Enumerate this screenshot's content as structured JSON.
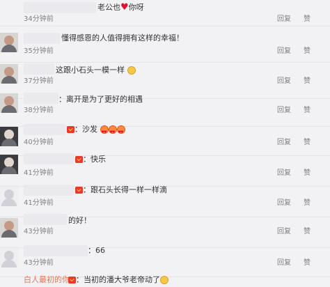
{
  "actions": {
    "reply_label": "回复",
    "like_label": "赞"
  },
  "comments": [
    {
      "name": "",
      "text": "老公也",
      "text2": "你呀",
      "time": "34分钟前"
    },
    {
      "name": "",
      "text": "懂得感恩的人值得拥有这样的幸福！",
      "time": "35分钟前"
    },
    {
      "name": "",
      "text": "这跟小石头一模一样",
      "time": "37分钟前"
    },
    {
      "name": "",
      "text": "：离开是为了更好的相遇",
      "time": "38分钟前"
    },
    {
      "name": "",
      "text": "：沙发",
      "time": "40分钟前"
    },
    {
      "name": "",
      "text": "：快乐",
      "time": "41分钟前"
    },
    {
      "name": "",
      "text": "：跟石头长得一样一样滴",
      "time": "41分钟前"
    },
    {
      "name": "",
      "text": "的好！",
      "time": "43分钟前"
    },
    {
      "name": "",
      "text": "：66",
      "time": "43分钟前"
    },
    {
      "name": "白人最初的你",
      "text": "：当初的潘大爷老帝动了",
      "time": ""
    }
  ],
  "icons": {
    "vip": "vip-badge-icon",
    "heart": "heart-emoji-icon",
    "face": "smile-emoji-icon",
    "love": "love-emoji-icon",
    "laugh": "laugh-emoji-icon"
  },
  "colors": {
    "name": "#eb7350",
    "time": "#808080",
    "background": "#f2f2f5"
  }
}
